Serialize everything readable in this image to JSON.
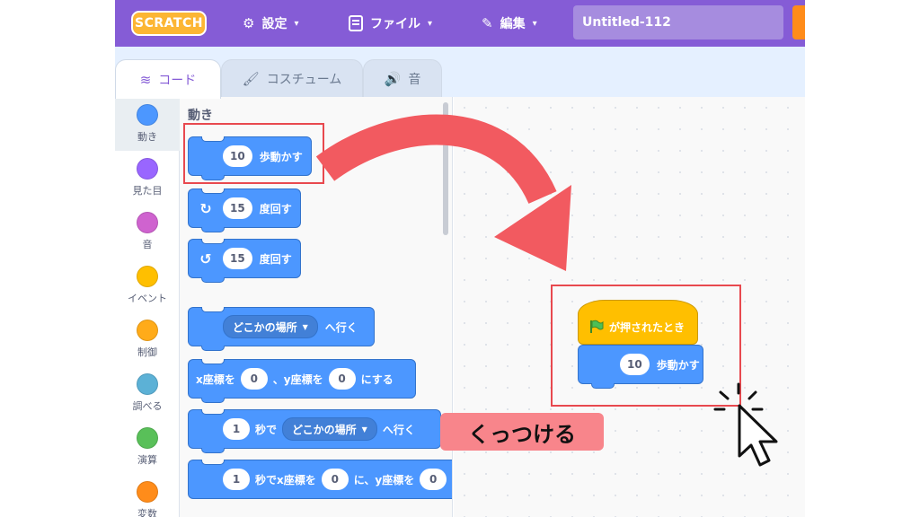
{
  "header": {
    "logo": "SCRATCH",
    "menu_settings": "設定",
    "menu_file": "ファイル",
    "menu_edit": "編集",
    "project_title": "Untitled-112",
    "caret": "▾",
    "settings_icon": "gear-icon",
    "file_icon": "file-icon",
    "edit_icon": "pencil-icon"
  },
  "tabs": {
    "code": "コード",
    "costume": "コスチューム",
    "sound": "音"
  },
  "categories": [
    {
      "label": "動き",
      "color": "#4c97ff"
    },
    {
      "label": "見た目",
      "color": "#9966ff"
    },
    {
      "label": "音",
      "color": "#cf63cf"
    },
    {
      "label": "イベント",
      "color": "#ffbf00"
    },
    {
      "label": "制御",
      "color": "#ffab19"
    },
    {
      "label": "調べる",
      "color": "#5cb1d6"
    },
    {
      "label": "演算",
      "color": "#59c059"
    },
    {
      "label": "変数",
      "color": "#ff8c1a"
    }
  ],
  "palette": {
    "section_title": "動き",
    "move": {
      "value": "10",
      "text": "歩動かす"
    },
    "turn_right": {
      "icon": "↻",
      "value": "15",
      "text": "度回す"
    },
    "turn_left": {
      "icon": "↺",
      "value": "15",
      "text": "度回す"
    },
    "goto": {
      "dropdown": "どこかの場所",
      "text": "へ行く"
    },
    "goto_xy": {
      "x_label": "x座標を",
      "x_value": "0",
      "sep": "、y座標を",
      "y_value": "0",
      "suffix": "にする"
    },
    "glide": {
      "value": "1",
      "mid": "秒で",
      "dropdown": "どこかの場所",
      "suffix": "へ行く"
    },
    "glide_xy": {
      "value": "1",
      "mid": "秒でx座標を",
      "x_value": "0",
      "sep": "に、y座標を",
      "y_value": "0"
    }
  },
  "workspace": {
    "hat_text": "が押されたとき",
    "flag_icon": "green-flag-icon",
    "move_value": "10",
    "move_text": "歩動かす"
  },
  "annotation": {
    "callout": "くっつける",
    "highlight_color": "#e8494f",
    "arrow_color": "#f25a60"
  }
}
